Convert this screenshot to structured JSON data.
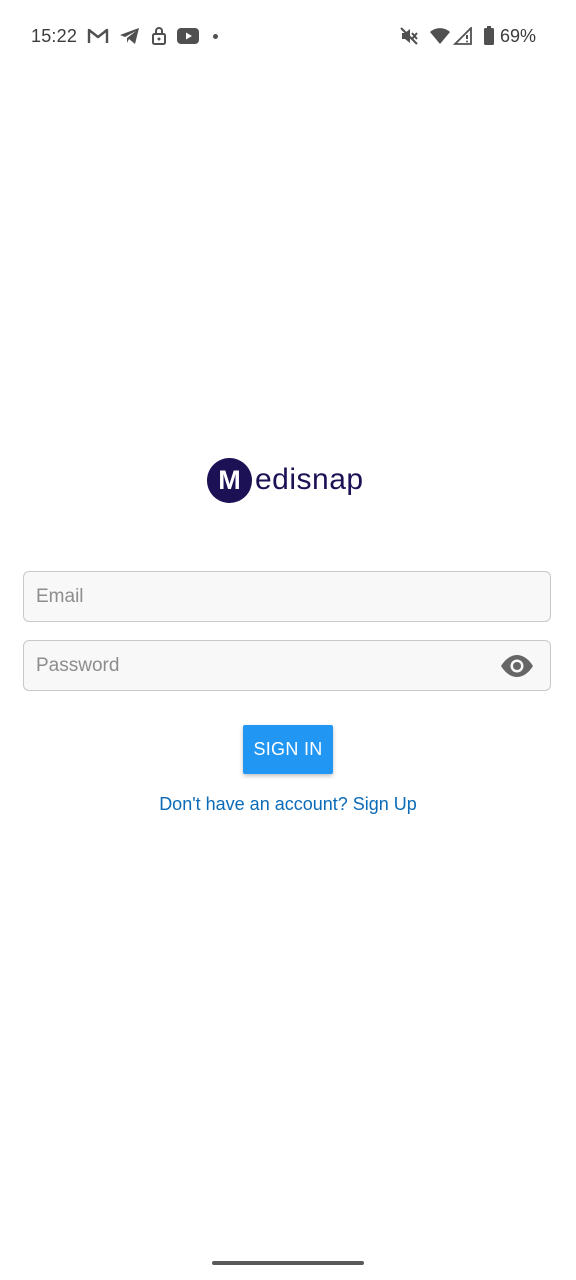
{
  "status_bar": {
    "time": "15:22",
    "notification_icons": [
      "gmail-icon",
      "telegram-icon",
      "lock-icon",
      "youtube-icon",
      "more-dot-icon"
    ],
    "system_icons": [
      "mute-icon",
      "wifi-icon",
      "cell-signal-icon",
      "battery-icon"
    ],
    "battery_percent": "69%"
  },
  "logo": {
    "badge_letter": "M",
    "wordmark": "edisnap",
    "brand_color": "#1b1154"
  },
  "form": {
    "email_placeholder": "Email",
    "email_value": "",
    "password_placeholder": "Password",
    "password_value": "",
    "password_toggle_icon": "eye-icon",
    "sign_in_label": "SIGN IN",
    "signup_link": "Don't have an account? Sign Up"
  },
  "colors": {
    "primary_button": "#2196f3",
    "link": "#0b6bb8"
  }
}
